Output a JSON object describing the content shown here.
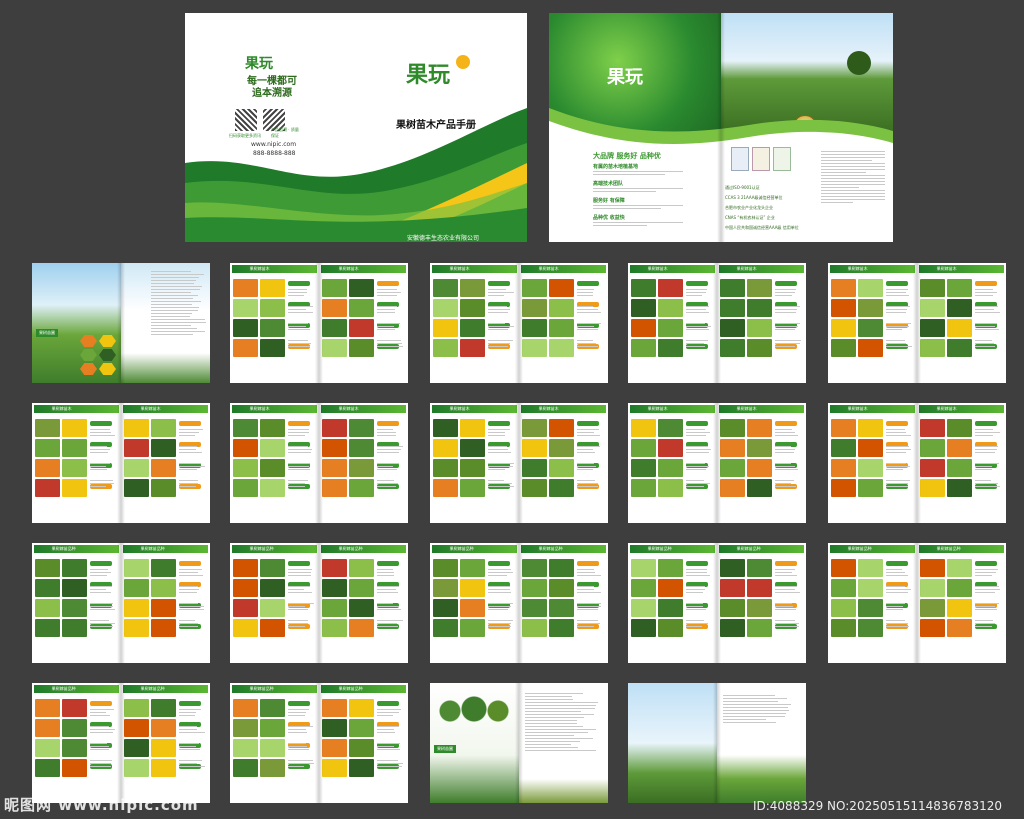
{
  "cover": {
    "brand_logo": "果玩",
    "slogan_line1": "每一棵都可",
    "slogan_line2": "追本溯源",
    "qr_caption_1": "扫码获取更多资讯",
    "qr_caption_2": "产品追溯 · 质量保证",
    "website": "www.nipic.com",
    "phone": "888-8888-888",
    "title": "果树苗木产品手册",
    "company": "安徽德丰生态农业有限公司"
  },
  "intro": {
    "brand_logo": "果玩",
    "tagline": "大品牌 服务好 品种优",
    "items": [
      {
        "heading": "有属的苗木培植基地"
      },
      {
        "heading": "高端技术团队"
      },
      {
        "heading": "服务好 有保障"
      },
      {
        "heading": "品种优 收益快"
      }
    ],
    "certs": [
      "通过ISO-9001认证",
      "CCAS 3 21AAA级诚信经营单位",
      "合肥市农业产业化龙头企业",
      "CNAS “有机农林认证” 企业",
      "中国人民共和国诚信经营AAA级 信用单位"
    ]
  },
  "page_header": "果树嫁苗木",
  "page_header_alt": "果树嫁苗品种",
  "about_badge": "果树苗圃",
  "watermark_left": "昵图网 www.nipic.com",
  "watermark_right": "ID:4088329 NO:20250515114836783120",
  "colors": {
    "green_dark": "#1f7a2a",
    "green_light": "#7cc242",
    "yellow": "#f5c518",
    "orange": "#f09a1a",
    "background": "#3e3e3e"
  }
}
